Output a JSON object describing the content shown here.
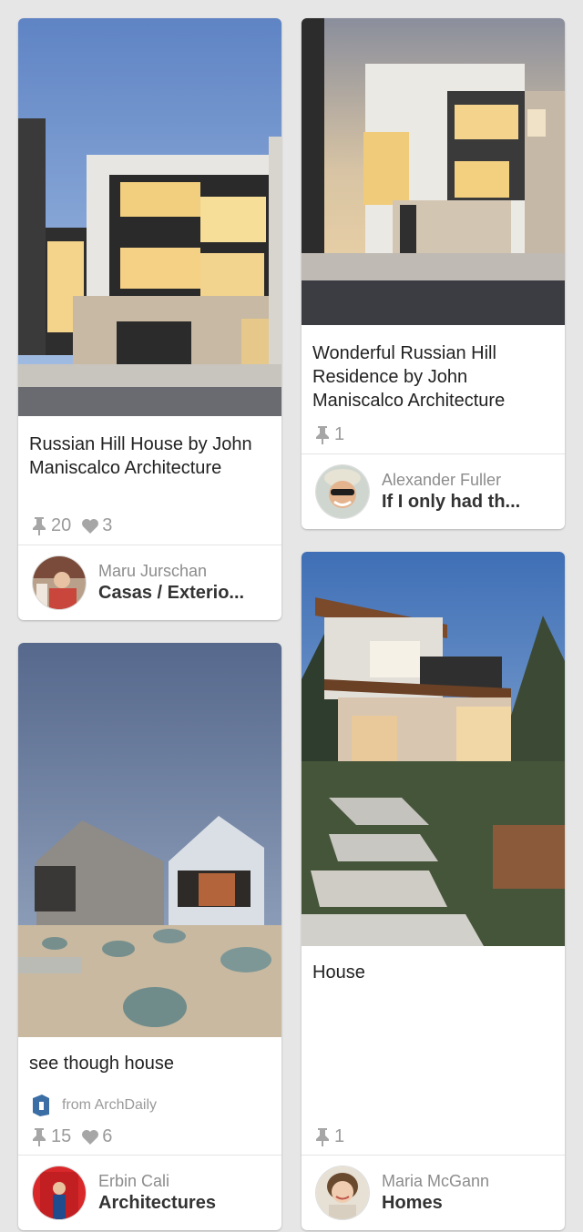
{
  "pins": [
    {
      "image": "Modern multi-story house at dusk with lit windows and stone garage",
      "title": "Russian Hill House by John Maniscalco Architecture",
      "repins": "20",
      "likes": "3",
      "pinner": "Maru Jurschan",
      "board": "Casas / Exterio..."
    },
    {
      "image": "Modern white residence with glowing windows at sunset",
      "title": "Wonderful Russian Hill Residence by John Maniscalco Architecture",
      "repins": "1",
      "pinner": "Alexander Fuller",
      "board": "If I only had th..."
    },
    {
      "image": "Two gabled barn houses with gravel garden under cloudy sky",
      "title": "see though house",
      "source": "from ArchDaily",
      "repins": "15",
      "likes": "6",
      "pinner": "Erbin Cali",
      "board": "Architectures"
    },
    {
      "image": "Contemporary wood house with stepping stone path at dusk",
      "title": "House",
      "repins": "1",
      "pinner": "Maria McGann",
      "board": "Homes"
    }
  ],
  "icons": {
    "repin": "pushpin-icon",
    "like": "heart-icon",
    "source": "archdaily-icon"
  },
  "colors": {
    "background": "#e6e6e6",
    "card": "#ffffff",
    "muted_text": "#9a9a9a"
  }
}
